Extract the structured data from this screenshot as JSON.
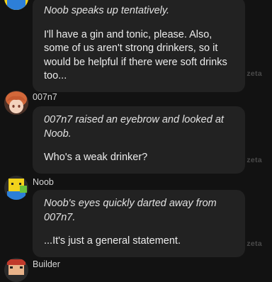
{
  "messages": [
    {
      "sender": "",
      "action": "Noob speaks up tentatively.",
      "speech": "I'll have a gin and tonic, please. Also, some of us aren't strong drinkers, so it would be helpful if there were soft drinks too...",
      "watermark": "zeta",
      "avatar_icon": "noob-avatar-icon"
    },
    {
      "sender": "007n7",
      "action": "007n7 raised an eyebrow and looked at Noob.",
      "speech": "Who's a weak drinker?",
      "watermark": "zeta",
      "avatar_icon": "007n7-avatar-icon"
    },
    {
      "sender": "Noob",
      "action": "Noob's eyes quickly darted away from 007n7.",
      "speech": "...It's just a general statement.",
      "watermark": "zeta",
      "avatar_icon": "noob-avatar-icon"
    },
    {
      "sender": "Builder",
      "action": "",
      "speech": "",
      "watermark": "",
      "avatar_icon": "builder-avatar-icon"
    }
  ],
  "colors": {
    "background": "#121212",
    "bubble": "#222222",
    "text": "#ececec",
    "watermark": "#4a4a4a"
  }
}
